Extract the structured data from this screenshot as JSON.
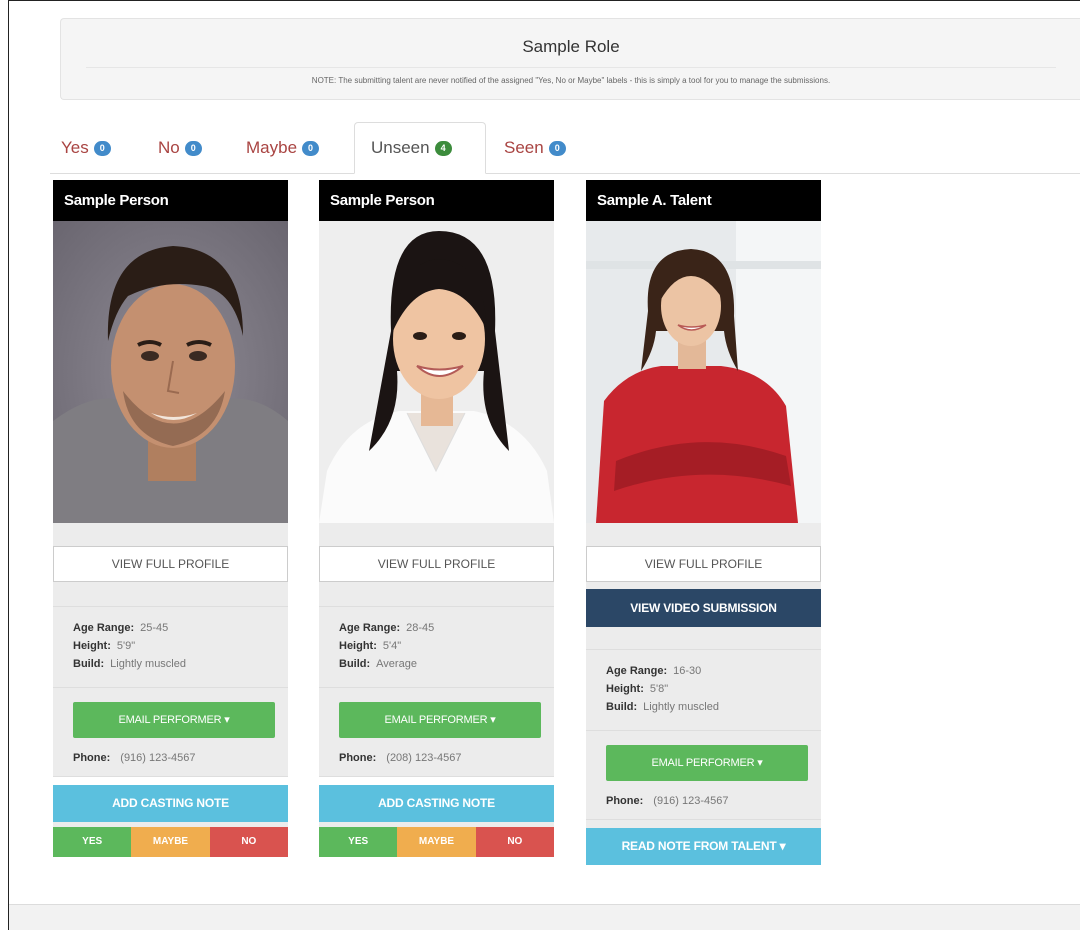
{
  "role": {
    "title": "Sample Role",
    "note": "NOTE: The submitting talent are never notified of the assigned \"Yes, No or Maybe\" labels - this is simply a tool for you to manage the submissions."
  },
  "tabs": [
    {
      "label": "Yes",
      "count": "0"
    },
    {
      "label": "No",
      "count": "0"
    },
    {
      "label": "Maybe",
      "count": "0"
    },
    {
      "label": "Unseen",
      "count": "4"
    },
    {
      "label": "Seen",
      "count": "0"
    }
  ],
  "cards": [
    {
      "name": "Sample Person",
      "view_profile": "VIEW FULL PROFILE",
      "age_label": "Age Range:",
      "age": "25-45",
      "height_label": "Height:",
      "height": "5'9\"",
      "build_label": "Build:",
      "build": "Lightly muscled",
      "email": "EMAIL PERFORMER ▾",
      "phone_label": "Phone:",
      "phone": "(916) 123-4567",
      "casting_note": "ADD CASTING NOTE",
      "yes": "YES",
      "maybe": "MAYBE",
      "no": "NO"
    },
    {
      "name": "Sample Person",
      "view_profile": "VIEW FULL PROFILE",
      "age_label": "Age Range:",
      "age": "28-45",
      "height_label": "Height:",
      "height": "5'4\"",
      "build_label": "Build:",
      "build": "Average",
      "email": "EMAIL PERFORMER ▾",
      "phone_label": "Phone:",
      "phone": "(208) 123-4567",
      "casting_note": "ADD CASTING NOTE",
      "yes": "YES",
      "maybe": "MAYBE",
      "no": "NO"
    },
    {
      "name": "Sample A. Talent",
      "view_profile": "VIEW FULL PROFILE",
      "video": "VIEW VIDEO SUBMISSION",
      "age_label": "Age Range:",
      "age": "16-30",
      "height_label": "Height:",
      "height": "5'8\"",
      "build_label": "Build:",
      "build": "Lightly muscled",
      "email": "EMAIL PERFORMER ▾",
      "phone_label": "Phone:",
      "phone": "(916) 123-4567",
      "read_note": "READ NOTE FROM TALENT ▾"
    }
  ],
  "colors": {
    "tab_text": "#a94442",
    "badge": "#428bca",
    "badge_active": "#3c8c3c",
    "success": "#5cb85c",
    "warning": "#f0ad4e",
    "danger": "#d9534f",
    "info": "#5bc0de",
    "video": "#2b4766"
  }
}
